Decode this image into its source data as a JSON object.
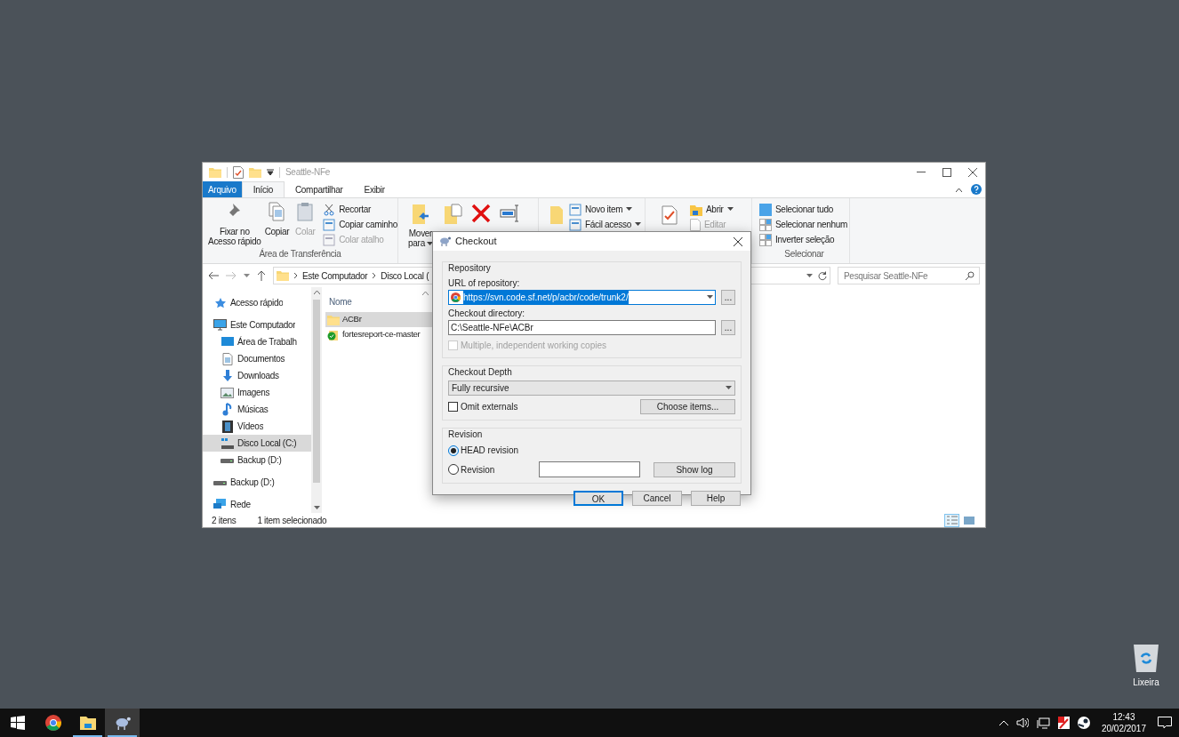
{
  "explorer": {
    "title": "Seattle-NFe",
    "tabs": [
      {
        "label": "Arquivo",
        "kind": "menu",
        "selected": false
      },
      {
        "label": "Início",
        "kind": "tab",
        "selected": true
      },
      {
        "label": "Compartilhar",
        "kind": "tab",
        "selected": false
      },
      {
        "label": "Exibir",
        "kind": "tab",
        "selected": false
      }
    ],
    "ribbon": {
      "clipboard": {
        "label": "Área de Transferência",
        "large": [
          {
            "label": "Fixar no Acesso rápido",
            "disabled": false
          },
          {
            "label": "Copiar",
            "disabled": false
          },
          {
            "label": "Colar",
            "disabled": true
          }
        ],
        "small": [
          {
            "label": "Recortar",
            "disabled": false
          },
          {
            "label": "Copiar caminho",
            "disabled": false
          },
          {
            "label": "Colar atalho",
            "disabled": true
          }
        ]
      },
      "organize": {
        "move_label": "Mover para"
      },
      "new": {
        "small": [
          {
            "label": "Novo item",
            "dropdown": true,
            "disabled": false
          },
          {
            "label": "Fácil acesso",
            "dropdown": true,
            "disabled": false
          }
        ]
      },
      "open": {
        "small": [
          {
            "label": "Abrir",
            "dropdown": true,
            "disabled": false
          },
          {
            "label": "Editar",
            "dropdown": false,
            "disabled": true
          }
        ]
      },
      "select": {
        "label": "Selecionar",
        "small": [
          {
            "label": "Selecionar tudo"
          },
          {
            "label": "Selecionar nenhum"
          },
          {
            "label": "Inverter seleção"
          }
        ]
      }
    },
    "address": {
      "crumbs": [
        "Este Computador",
        "Disco Local ("
      ]
    },
    "search": {
      "placeholder": "Pesquisar Seattle-NFe"
    },
    "nav": [
      {
        "label": "Acesso rápido",
        "kind": "quick",
        "selected": false
      },
      {
        "label": "Este Computador",
        "kind": "computer",
        "selected": false,
        "children": [
          {
            "label": "Área de Trabalh",
            "kind": "desktop",
            "selected": false
          },
          {
            "label": "Documentos",
            "kind": "documents",
            "selected": false
          },
          {
            "label": "Downloads",
            "kind": "downloads",
            "selected": false
          },
          {
            "label": "Imagens",
            "kind": "pictures",
            "selected": false
          },
          {
            "label": "Músicas",
            "kind": "music",
            "selected": false
          },
          {
            "label": "Vídeos",
            "kind": "videos",
            "selected": false
          },
          {
            "label": "Disco Local (C:)",
            "kind": "system",
            "selected": true
          },
          {
            "label": "Backup (D:)",
            "kind": "drive",
            "selected": false
          }
        ]
      },
      {
        "label": "Backup (D:)",
        "kind": "drive",
        "selected": false
      },
      {
        "label": "Rede",
        "kind": "network",
        "selected": false
      }
    ],
    "files": {
      "columns": [
        "Nome"
      ],
      "rows": [
        {
          "name": "ACBr",
          "kind": "folder",
          "selected": true
        },
        {
          "name": "fortesreport-ce-master",
          "kind": "versioned",
          "selected": false
        }
      ]
    },
    "status_bar": {
      "count": "2 itens",
      "selection": "1 item selecionado"
    },
    "view_buttons": [
      {
        "kind": "details",
        "selected": true
      },
      {
        "kind": "preview",
        "selected": false
      }
    ]
  },
  "dialog": {
    "title": "Checkout",
    "repository": {
      "label": "Repository",
      "url_label": "URL of repository:",
      "url": "https://svn.code.sf.net/p/acbr/code/trunk2/",
      "url_highlighted": true,
      "browse_buttons": [
        "...",
        "..."
      ],
      "dir_label": "Checkout directory:",
      "directory": "C:\\Seattle-NFe\\ACBr",
      "multiple": {
        "label": "Multiple, independent working copies",
        "checked": false,
        "disabled": true
      }
    },
    "depth": {
      "label": "Checkout Depth",
      "value": "Fully recursive",
      "omit_externals": {
        "label": "Omit externals",
        "checked": false,
        "disabled": false
      },
      "choose_button": "Choose items..."
    },
    "revision": {
      "label": "Revision",
      "options": [
        {
          "label": "HEAD revision",
          "selected": true
        },
        {
          "label": "Revision",
          "selected": false
        }
      ],
      "show_log": "Show log"
    },
    "buttons": [
      {
        "label": "OK",
        "default": true
      },
      {
        "label": "Cancel",
        "default": false
      },
      {
        "label": "Help",
        "default": false
      }
    ]
  },
  "desktop_icons": [
    {
      "label": "Lixeira"
    }
  ],
  "taskbar": {
    "apps": [
      {
        "kind": "browser",
        "running": false,
        "selected": false
      },
      {
        "kind": "explorer",
        "running": true,
        "selected": false
      },
      {
        "kind": "tortoise",
        "running": true,
        "selected": true
      }
    ],
    "clock": {
      "time": "12:43",
      "date": "20/02/2017"
    }
  }
}
